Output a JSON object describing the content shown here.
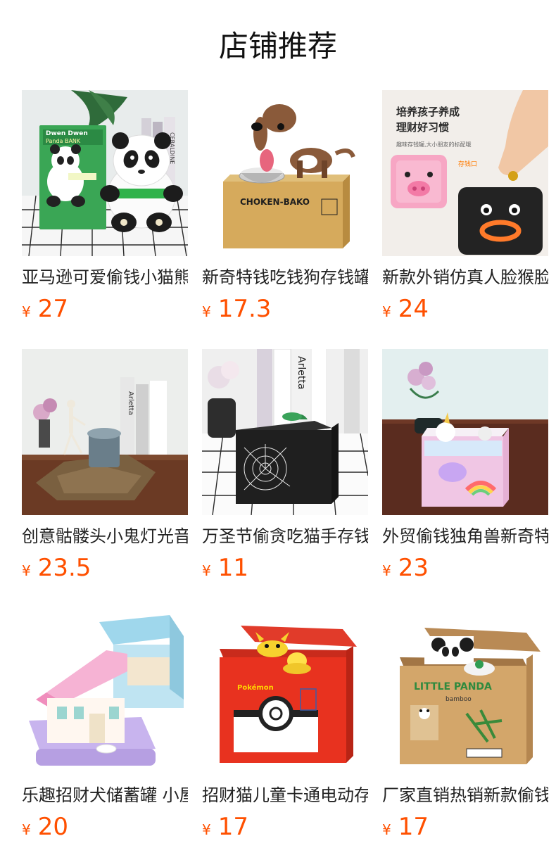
{
  "page": {
    "title": "店铺推荐"
  },
  "products": [
    {
      "name": "亚马逊可爱偷钱小猫熊存钱罐",
      "currency": "¥",
      "price": "27"
    },
    {
      "name": "新奇特钱吃钱狗存钱罐储蓄罐",
      "currency": "¥",
      "price": "17.3"
    },
    {
      "name": "新款外销仿真人脸猴脸存钱罐",
      "currency": "¥",
      "price": "24"
    },
    {
      "name": "创意骷髅头小鬼灯光音乐存钱罐",
      "currency": "¥",
      "price": "23.5"
    },
    {
      "name": "万圣节偷贪吃猫手存钱罐",
      "currency": "¥",
      "price": "11"
    },
    {
      "name": "外贸偷钱独角兽新奇特存钱罐",
      "currency": "¥",
      "price": "23"
    },
    {
      "name": "乐趣招财犬储蓄罐 小屋存钱罐",
      "currency": "¥",
      "price": "20"
    },
    {
      "name": "招财猫儿童卡通电动存钱罐",
      "currency": "¥",
      "price": "17"
    },
    {
      "name": "厂家直销热销新款偷钱熊猫存钱罐",
      "currency": "¥",
      "price": "17"
    }
  ],
  "image_text": {
    "p1_box_brand": "Dwen Dwen",
    "p1_box_sub": "Panda BANK",
    "p1_books": "CERALDINE",
    "p2_box_label": "CHOKEN-BAKO",
    "p3_headline_1": "培养孩子养成",
    "p3_headline_2": "理财好习惯",
    "p3_sub": "趣味存钱罐,大小朋友的标配哦",
    "p3_slot_label": "存钱口",
    "p4_books": "Arletta",
    "p5_books": "Arletta",
    "p8_brand": "Pokémon",
    "p9_brand": "LITTLE PANDA",
    "p9_sub": "bamboo"
  },
  "icons": {
    "currency": "yen-sign"
  },
  "colors": {
    "price": "#ff5000",
    "title": "#111111",
    "name": "#222222"
  }
}
